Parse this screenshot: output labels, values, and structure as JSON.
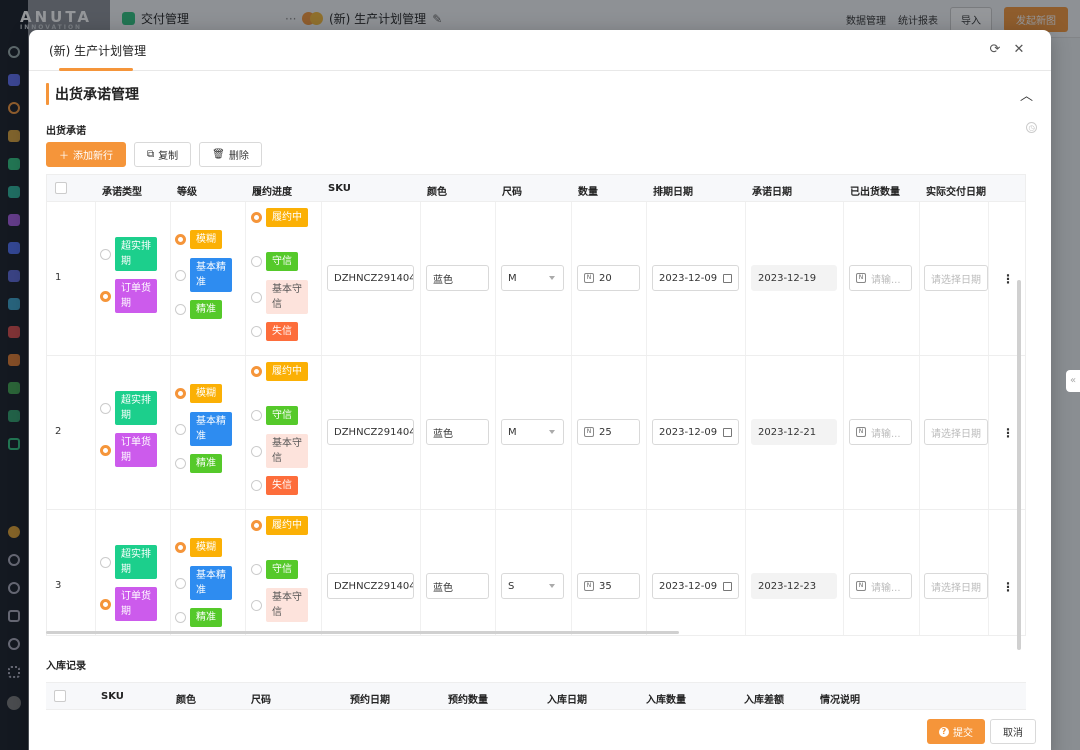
{
  "app": {
    "logo": "ANUTA",
    "logo_sub": "INNOVATION",
    "bg_tabs": [
      {
        "label": "交付管理"
      },
      {
        "label": "(新) 生产计划管理"
      }
    ],
    "bg_tools": {
      "data_manage": "数据管理",
      "stats": "统计报表",
      "import": "导入",
      "launch": "发起新图"
    }
  },
  "modal": {
    "title": "(新) 生产计划管理",
    "section_title": "出货承诺管理",
    "sub_title": "出货承诺",
    "toolbar": {
      "add": "添加新行",
      "copy": "复制",
      "delete": "删除"
    },
    "columns": [
      "承诺类型",
      "等级",
      "履约进度",
      "SKU",
      "颜色",
      "尺码",
      "数量",
      "排期日期",
      "承诺日期",
      "已出货数量",
      "实际交付日期"
    ],
    "rows": [
      {
        "index": "1",
        "commit_types": [
          {
            "label": "超实排期",
            "color": "green",
            "selected": false
          },
          {
            "label": "订单货期",
            "color": "purple",
            "selected": true
          }
        ],
        "levels": [
          {
            "label": "模糊",
            "color": "yellow",
            "selected": true
          },
          {
            "label": "基本精准",
            "color": "blue",
            "selected": false
          },
          {
            "label": "精准",
            "color": "lime",
            "selected": false
          }
        ],
        "progress": [
          {
            "label": "履约中",
            "color": "yellow",
            "selected": true
          },
          {
            "label": "守信",
            "color": "lime",
            "selected": false
          },
          {
            "label": "基本守信",
            "color": "pink",
            "selected": false
          },
          {
            "label": "失信",
            "color": "red",
            "selected": false
          }
        ],
        "sku": "DZHNCZ291404-",
        "color": "蓝色",
        "size": "M",
        "qty": "20",
        "schedule_date": "2023-12-09",
        "commit_date": "2023-12-19",
        "shipped_qty_placeholder": "请输...",
        "actual_date_placeholder": "请选择日期"
      },
      {
        "index": "2",
        "commit_types": [
          {
            "label": "超实排期",
            "color": "green",
            "selected": false
          },
          {
            "label": "订单货期",
            "color": "purple",
            "selected": true
          }
        ],
        "levels": [
          {
            "label": "模糊",
            "color": "yellow",
            "selected": true
          },
          {
            "label": "基本精准",
            "color": "blue",
            "selected": false
          },
          {
            "label": "精准",
            "color": "lime",
            "selected": false
          }
        ],
        "progress": [
          {
            "label": "履约中",
            "color": "yellow",
            "selected": true
          },
          {
            "label": "守信",
            "color": "lime",
            "selected": false
          },
          {
            "label": "基本守信",
            "color": "pink",
            "selected": false
          },
          {
            "label": "失信",
            "color": "red",
            "selected": false
          }
        ],
        "sku": "DZHNCZ291404-",
        "color": "蓝色",
        "size": "M",
        "qty": "25",
        "schedule_date": "2023-12-09",
        "commit_date": "2023-12-21",
        "shipped_qty_placeholder": "请输...",
        "actual_date_placeholder": "请选择日期"
      },
      {
        "index": "3",
        "commit_types": [
          {
            "label": "超实排期",
            "color": "green",
            "selected": false
          },
          {
            "label": "订单货期",
            "color": "purple",
            "selected": true
          }
        ],
        "levels": [
          {
            "label": "模糊",
            "color": "yellow",
            "selected": true
          },
          {
            "label": "基本精准",
            "color": "blue",
            "selected": false
          },
          {
            "label": "精准",
            "color": "lime",
            "selected": false
          }
        ],
        "progress": [
          {
            "label": "履约中",
            "color": "yellow",
            "selected": true
          },
          {
            "label": "守信",
            "color": "lime",
            "selected": false
          },
          {
            "label": "基本守信",
            "color": "pink",
            "selected": false
          }
        ],
        "sku": "DZHNCZ291404-",
        "color": "蓝色",
        "size": "S",
        "qty": "35",
        "schedule_date": "2023-12-09",
        "commit_date": "2023-12-23",
        "shipped_qty_placeholder": "请输...",
        "actual_date_placeholder": "请选择日期"
      }
    ],
    "inbound_title": "入库记录",
    "inbound_columns": [
      "SKU",
      "颜色",
      "尺码",
      "预约日期",
      "预约数量",
      "入库日期",
      "入库数量",
      "入库差额",
      "情况说明"
    ],
    "footer": {
      "submit": "提交",
      "cancel": "取消"
    }
  },
  "colors": {
    "accent": "#f5953a",
    "green": "#1ccf8c",
    "purple": "#cc5bec",
    "yellow": "#fbb005",
    "blue": "#2e8cf0",
    "lime": "#55c92a",
    "pink": "#fde3dc",
    "red": "#fd6d3b"
  }
}
